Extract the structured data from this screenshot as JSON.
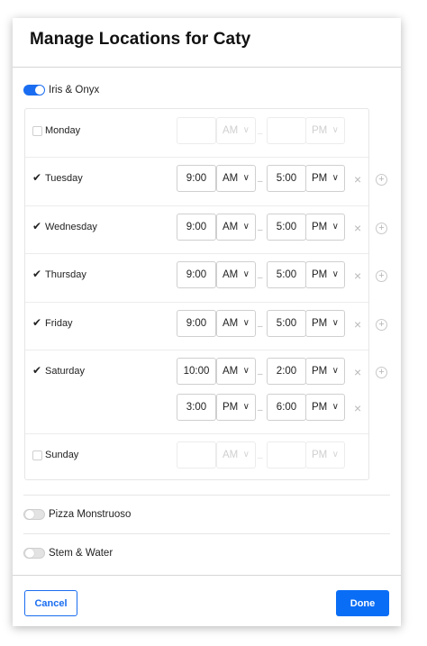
{
  "modal": {
    "title": "Manage Locations for Caty"
  },
  "locations": [
    {
      "name": "Iris & Onyx",
      "enabled": true
    },
    {
      "name": "Pizza Monstruoso",
      "enabled": false
    },
    {
      "name": "Stem & Water",
      "enabled": false
    }
  ],
  "schedule": {
    "separator": "–",
    "days": [
      {
        "day": "Monday",
        "checked": false,
        "ranges": [
          {
            "start": "",
            "start_period": "AM",
            "end": "",
            "end_period": "PM"
          }
        ]
      },
      {
        "day": "Tuesday",
        "checked": true,
        "ranges": [
          {
            "start": "9:00",
            "start_period": "AM",
            "end": "5:00",
            "end_period": "PM"
          }
        ]
      },
      {
        "day": "Wednesday",
        "checked": true,
        "ranges": [
          {
            "start": "9:00",
            "start_period": "AM",
            "end": "5:00",
            "end_period": "PM"
          }
        ]
      },
      {
        "day": "Thursday",
        "checked": true,
        "ranges": [
          {
            "start": "9:00",
            "start_period": "AM",
            "end": "5:00",
            "end_period": "PM"
          }
        ]
      },
      {
        "day": "Friday",
        "checked": true,
        "ranges": [
          {
            "start": "9:00",
            "start_period": "AM",
            "end": "5:00",
            "end_period": "PM"
          }
        ]
      },
      {
        "day": "Saturday",
        "checked": true,
        "ranges": [
          {
            "start": "10:00",
            "start_period": "AM",
            "end": "2:00",
            "end_period": "PM"
          },
          {
            "start": "3:00",
            "start_period": "PM",
            "end": "6:00",
            "end_period": "PM"
          }
        ]
      },
      {
        "day": "Sunday",
        "checked": false,
        "ranges": [
          {
            "start": "",
            "start_period": "AM",
            "end": "",
            "end_period": "PM"
          }
        ]
      }
    ]
  },
  "footer": {
    "cancel_label": "Cancel",
    "done_label": "Done"
  },
  "colors": {
    "accent": "#1a6df0",
    "done_button": "#0a6df5"
  },
  "icons": {
    "check": "checkmark-icon",
    "chevron": "chevron-down-icon",
    "remove": "close-icon",
    "add": "plus-circle-icon"
  }
}
